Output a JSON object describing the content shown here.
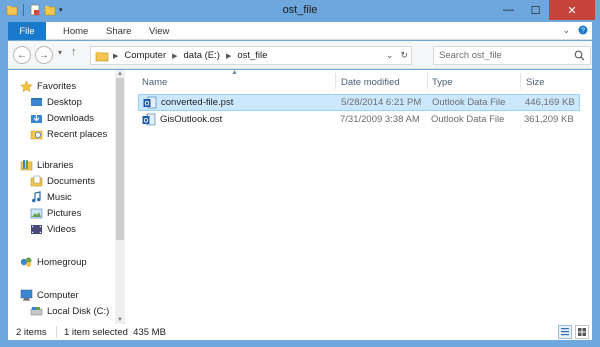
{
  "window": {
    "title": "ost_file",
    "buttons": {
      "minimize": "—",
      "maximize": "☐",
      "close": "✕"
    }
  },
  "ribbon": {
    "tabs": [
      {
        "label": "File"
      },
      {
        "label": "Home"
      },
      {
        "label": "Share"
      },
      {
        "label": "View"
      }
    ],
    "expand_icon": "chevron-down-icon",
    "help_icon": "help-icon"
  },
  "address_bar": {
    "segments": [
      "Computer",
      "data (E:)",
      "ost_file"
    ],
    "search_placeholder": "Search ost_file"
  },
  "navigation": {
    "favorites": {
      "label": "Favorites",
      "items": [
        "Desktop",
        "Downloads",
        "Recent places"
      ]
    },
    "libraries": {
      "label": "Libraries",
      "items": [
        "Documents",
        "Music",
        "Pictures",
        "Videos"
      ]
    },
    "homegroup": {
      "label": "Homegroup"
    },
    "computer": {
      "label": "Computer",
      "items": [
        "Local Disk (C:)"
      ]
    }
  },
  "file_list": {
    "columns": [
      "Name",
      "Date modified",
      "Type",
      "Size"
    ],
    "rows": [
      {
        "name": "converted-file.pst",
        "date": "5/28/2014 6:21 PM",
        "type": "Outlook Data File",
        "size": "446,169 KB",
        "selected": true
      },
      {
        "name": "GisOutlook.ost",
        "date": "7/31/2009 3:38 AM",
        "type": "Outlook Data File",
        "size": "361,209 KB",
        "selected": false
      }
    ]
  },
  "status_bar": {
    "item_count": "2 items",
    "selection": "1 item selected  435 MB"
  },
  "colors": {
    "title_bar": "#6ea7dd",
    "file_tab": "#1979ca",
    "close_button": "#c7443a",
    "selection_fill": "#cce8ff",
    "selection_border": "#99d1ff"
  }
}
